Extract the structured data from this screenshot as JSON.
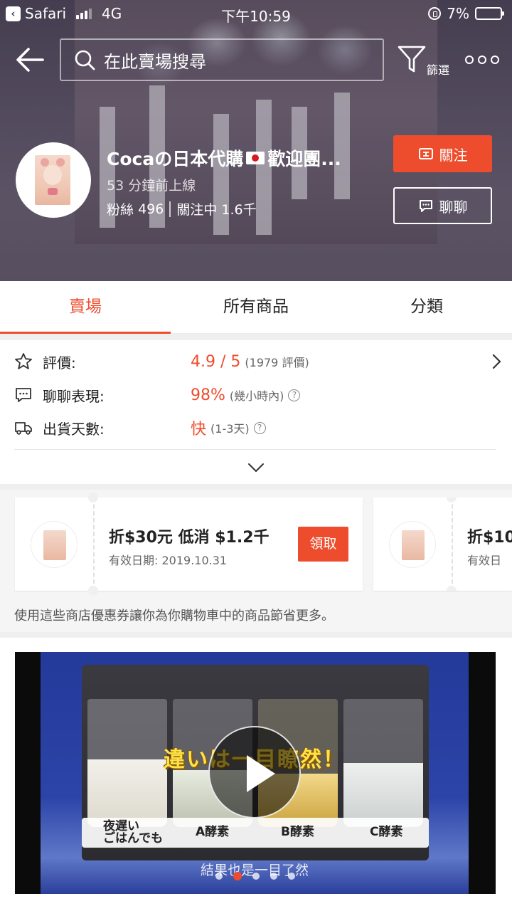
{
  "status_bar": {
    "back_app": "Safari",
    "network": "4G",
    "time": "下午10:59",
    "battery": "7%"
  },
  "header": {
    "search_placeholder": "在此賣場搜尋",
    "filter_label": "篩選"
  },
  "shop": {
    "name_prefix": "Cocaの日本代購",
    "name_suffix": "歡迎團...",
    "online": "53 分鐘前上線",
    "followers_label": "粉絲",
    "followers": "496",
    "following_label": "關注中",
    "following": "1.6千",
    "follow_button": "關注",
    "chat_button": "聊聊"
  },
  "tabs": [
    {
      "label": "賣場",
      "active": true
    },
    {
      "label": "所有商品",
      "active": false
    },
    {
      "label": "分類",
      "active": false
    }
  ],
  "stats": {
    "rating": {
      "label": "評價:",
      "value": "4.9 / 5",
      "note": "(1979 評價)"
    },
    "chat": {
      "label": "聊聊表現:",
      "value": "98%",
      "note": "(幾小時內)"
    },
    "shipping": {
      "label": "出貨天數:",
      "value": "快",
      "note": "(1-3天)"
    }
  },
  "vouchers": {
    "items": [
      {
        "title": "折$30元 低消 $1.2千",
        "date": "有效日期: 2019.10.31",
        "claim": "領取"
      },
      {
        "title": "折$10",
        "date": "有效日"
      }
    ],
    "hint": "使用這些商店優惠券讓你為你購物車中的商品節省更多。"
  },
  "video": {
    "caption": "違いは一目瞭然！",
    "labels": {
      "a": "夜遅い\nごはんでも",
      "b": "A酵素",
      "c": "B酵素",
      "d": "C酵素"
    },
    "subtitle": "結果也是一目了然",
    "active_slide": 2,
    "slide_count": 5
  },
  "colors": {
    "accent": "#ee4d2d",
    "header_bg": "#5e5569"
  }
}
